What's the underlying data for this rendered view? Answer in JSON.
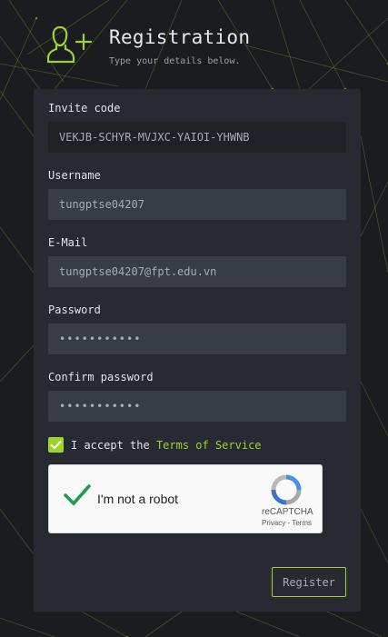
{
  "header": {
    "icon": "add-user-icon",
    "title": "Registration",
    "subtitle": "Type your details below."
  },
  "form": {
    "invite_code": {
      "label": "Invite code",
      "value": "VEKJB-SCHYR-MVJXC-YAIOI-YHWNB"
    },
    "username": {
      "label": "Username",
      "value": "tungptse04207"
    },
    "email": {
      "label": "E-Mail",
      "value": "tungptse04207@fpt.edu.vn"
    },
    "password": {
      "label": "Password",
      "value": "•••••••••••"
    },
    "confirm_password": {
      "label": "Confirm password",
      "value": "•••••••••••"
    },
    "accept": {
      "checked": true,
      "text": "I accept the",
      "link": "Terms of Service"
    },
    "recaptcha": {
      "label": "I'm not a robot",
      "checked": true,
      "brand": "reCAPTCHA",
      "privacy": "Privacy",
      "separator": " - ",
      "terms": "Terms"
    },
    "register_label": "Register"
  },
  "colors": {
    "accent": "#9fd42a",
    "background": "#1a1c20",
    "panel": "#282c33",
    "input": "#383d45"
  }
}
